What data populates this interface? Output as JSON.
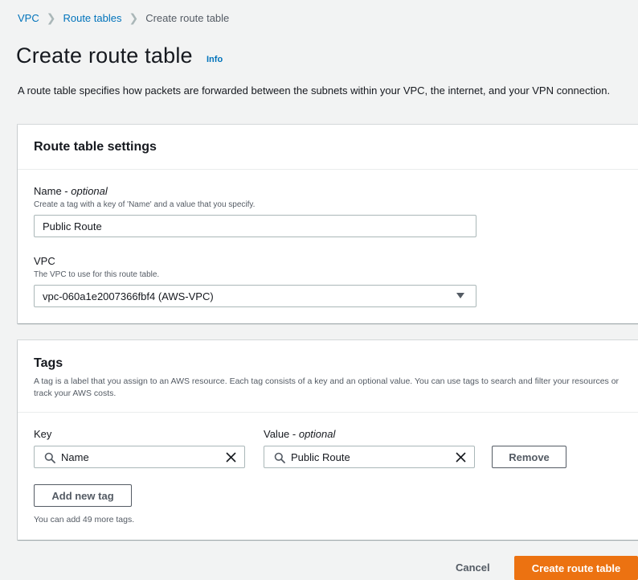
{
  "breadcrumb": {
    "items": [
      "VPC",
      "Route tables",
      "Create route table"
    ]
  },
  "page": {
    "title": "Create route table",
    "info_label": "Info",
    "description": "A route table specifies how packets are forwarded between the subnets within your VPC, the internet, and your VPN connection."
  },
  "settings": {
    "title": "Route table settings",
    "name_label": "Name - ",
    "name_optional": "optional",
    "name_hint": "Create a tag with a key of 'Name' and a value that you specify.",
    "name_value": "Public Route",
    "vpc_label": "VPC",
    "vpc_hint": "The VPC to use for this route table.",
    "vpc_value": "vpc-060a1e2007366fbf4 (AWS-VPC)"
  },
  "tags": {
    "title": "Tags",
    "description": "A tag is a label that you assign to an AWS resource. Each tag consists of a key and an optional value. You can use tags to search and filter your resources or track your AWS costs.",
    "key_label": "Key",
    "value_label": "Value - ",
    "value_optional": "optional",
    "rows": [
      {
        "key": "Name",
        "value": "Public Route"
      }
    ],
    "remove_label": "Remove",
    "add_label": "Add new tag",
    "limit_text": "You can add 49 more tags."
  },
  "footer": {
    "cancel_label": "Cancel",
    "create_label": "Create route table"
  },
  "colors": {
    "link": "#0073bb",
    "primary": "#ec7211",
    "background": "#f2f3f3"
  },
  "icons": [
    "chevron-right-icon",
    "search-icon",
    "close-icon",
    "caret-down-icon"
  ]
}
